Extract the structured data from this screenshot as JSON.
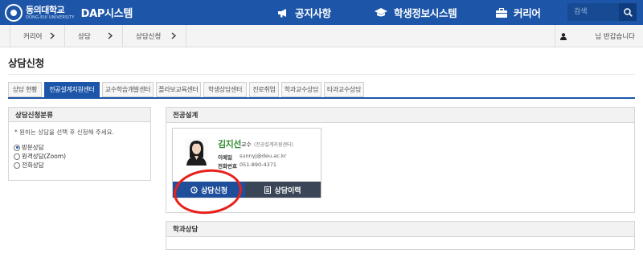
{
  "header": {
    "logo_kr": "동의대학교",
    "logo_en": "DONG-EUI UNIVERSITY",
    "system_name": "DAP시스템",
    "nav": [
      {
        "label": "공지사항",
        "icon": "megaphone-icon"
      },
      {
        "label": "학생정보시스템",
        "icon": "graduation-cap-icon"
      },
      {
        "label": "커리어",
        "icon": "briefcase-icon"
      }
    ],
    "search": {
      "placeholder": "검색",
      "value": "",
      "icon": "search-icon"
    }
  },
  "breadcrumb": {
    "items": [
      "커리어",
      "상담",
      "상담신청"
    ],
    "user_greeting": "님 반갑습니다",
    "user_icon": "person-icon"
  },
  "page": {
    "title": "상담신청"
  },
  "tabs": [
    {
      "label": "상담 현황",
      "active": false
    },
    {
      "label": "전공설계지원센터",
      "active": true
    },
    {
      "label": "교수학습개발센터",
      "active": false
    },
    {
      "label": "플라보교육센터",
      "active": false
    },
    {
      "label": "학생상담센터",
      "active": false
    },
    {
      "label": "진로취업",
      "active": false
    },
    {
      "label": "학과교수상담",
      "active": false
    },
    {
      "label": "타과교수상담",
      "active": false
    }
  ],
  "left_panel": {
    "title": "상담신청분류",
    "notice": "* 원하는 상담을 선택 후 신청해 주세요.",
    "options": [
      {
        "label": "방문상담",
        "checked": true
      },
      {
        "label": "원격상담(Zoom)",
        "checked": false
      },
      {
        "label": "전화상담",
        "checked": false
      }
    ]
  },
  "major_panel": {
    "title": "전공설계",
    "card": {
      "name": "김지선",
      "position": "교수",
      "department": "(전공설계지원센터)",
      "email_label": "이메일",
      "email": "sunnyj@deu.ac.kr",
      "phone_label": "전화번호",
      "phone": "051-890-4371",
      "apply_button": "상담신청",
      "history_button": "상담이력"
    }
  },
  "dept_panel": {
    "title": "학과상담"
  },
  "colors": {
    "brand_blue": "#1d56a8",
    "button_navy": "#1f4f9a",
    "button_slate": "#3a4658",
    "highlight_red": "#e8201a",
    "name_green": "#2e8b2e"
  }
}
